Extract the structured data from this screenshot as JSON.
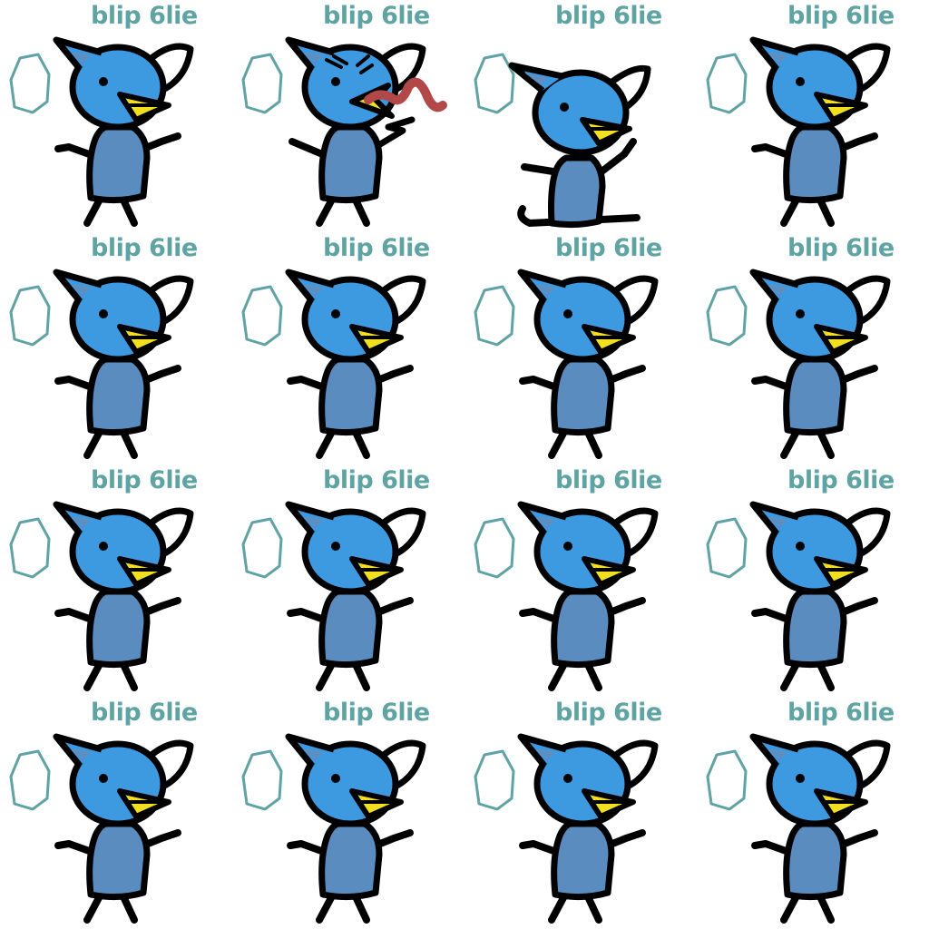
{
  "sheet": {
    "frame_label": "blip 6lie",
    "columns": 4,
    "rows": 4
  },
  "frames": [
    {
      "pose": "idle"
    },
    {
      "pose": "attack"
    },
    {
      "pose": "sit"
    },
    {
      "pose": "idle"
    },
    {
      "pose": "idle"
    },
    {
      "pose": "idle"
    },
    {
      "pose": "idle"
    },
    {
      "pose": "idle"
    },
    {
      "pose": "idle"
    },
    {
      "pose": "idle"
    },
    {
      "pose": "idle"
    },
    {
      "pose": "idle"
    },
    {
      "pose": "idle"
    },
    {
      "pose": "idle"
    },
    {
      "pose": "idle"
    },
    {
      "pose": "idle"
    }
  ],
  "icons": {
    "gem": "crystal-gem-icon",
    "character": "bird-cat-creature-icon",
    "attack_effect": "wavy-tongue-icon"
  },
  "colors": {
    "label": "#5fa3a3",
    "gem_outline": "#5fa3a3",
    "head": "#3d9ae0",
    "ear_inner": "#5f8ec3",
    "body": "#5b8cc0",
    "beak": "#f0e020",
    "outline": "#000000",
    "tongue": "#b24848"
  }
}
